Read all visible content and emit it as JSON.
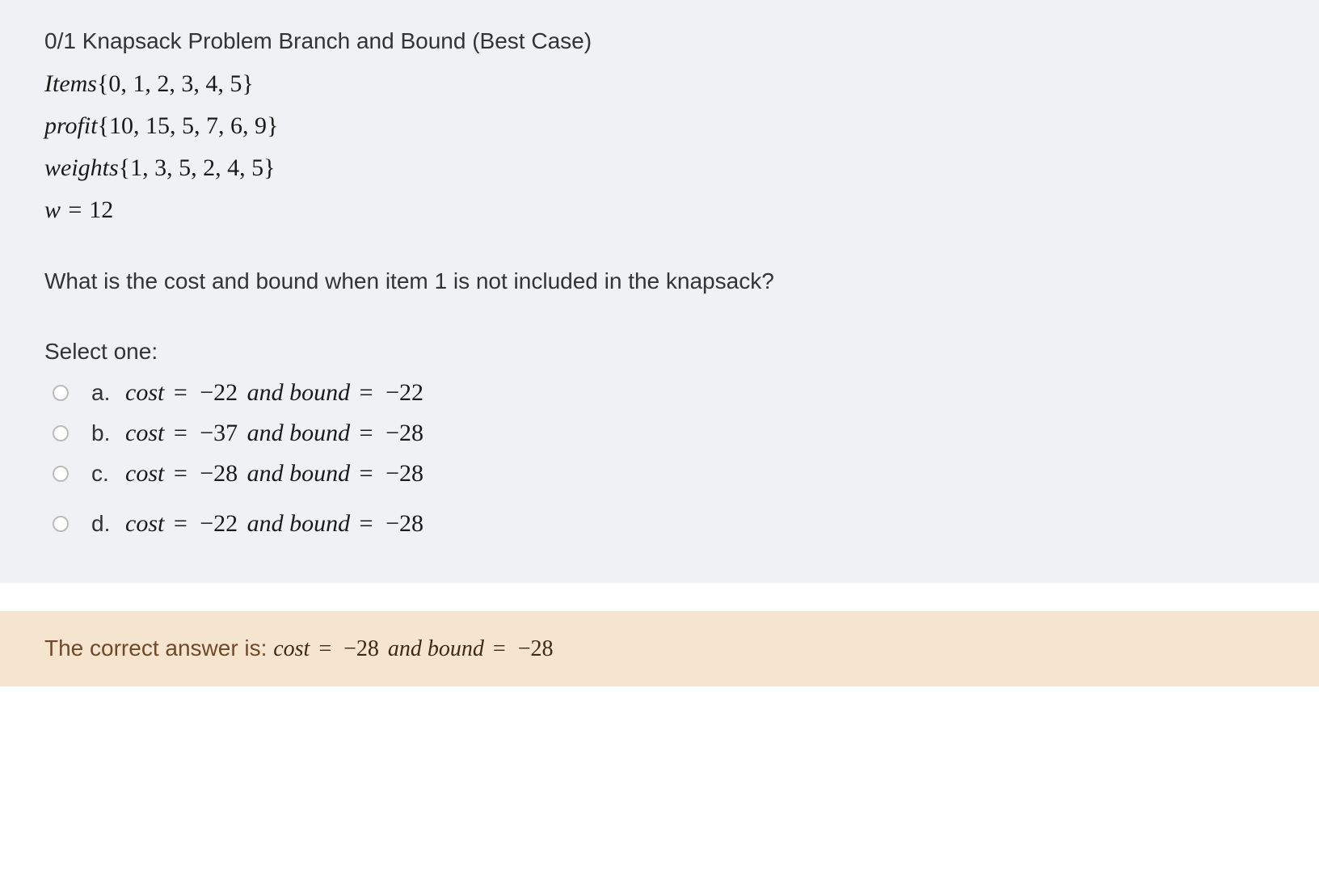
{
  "question": {
    "title": "0/1 Knapsack Problem Branch and Bound (Best Case)",
    "lines": {
      "items_label": "Items",
      "items_set": "{0, 1, 2, 3, 4, 5}",
      "profit_label": "profit",
      "profit_set": "{10, 15, 5, 7, 6, 9}",
      "weights_label": "weights",
      "weights_set": "{1, 3, 5, 2, 4, 5}",
      "w_label": "w",
      "w_value": "12"
    },
    "prompt": "What is the cost and bound when item 1 is not included in the knapsack?",
    "select_label": "Select one:"
  },
  "options": [
    {
      "letter": "a.",
      "cost": "−22",
      "bound": "−22"
    },
    {
      "letter": "b.",
      "cost": "−37",
      "bound": "−28"
    },
    {
      "letter": "c.",
      "cost": "−28",
      "bound": "−28"
    },
    {
      "letter": "d.",
      "cost": "−22",
      "bound": "−28"
    }
  ],
  "answer": {
    "prefix": "The correct answer is: ",
    "cost": "−28",
    "bound": "−28"
  },
  "labels": {
    "cost": "cost",
    "and_bound": " and bound",
    "eq": " = "
  }
}
